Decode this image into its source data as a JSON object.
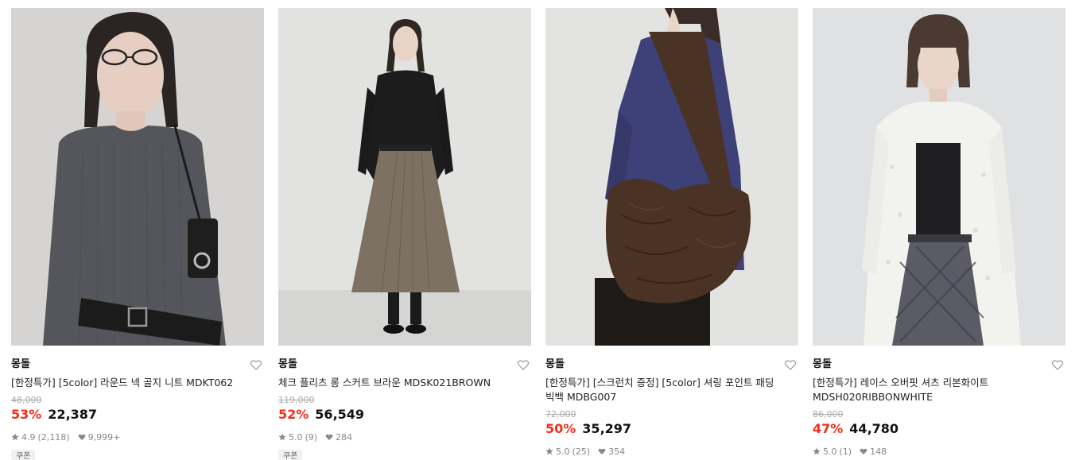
{
  "products": [
    {
      "brand": "몽돌",
      "name": "[한정특가] [5color] 라운드 넥 골지 니트 MDKT062",
      "original_price": "48,000",
      "discount": "53%",
      "price": "22,387",
      "rating": "4.9",
      "reviews": "(2,118)",
      "likes": "9,999+",
      "tag": "쿠폰",
      "image": "model-ribbed-knit-gray",
      "colors": {
        "bg": "#d9d8d6",
        "main": "#55565b",
        "accent": "#1e1e1e",
        "skin": "#e6cfc2",
        "hair": "#2a2522"
      }
    },
    {
      "brand": "몽돌",
      "name": "체크 플리츠 롱 스커트 브라운 MDSK021BROWN",
      "original_price": "119,000",
      "discount": "52%",
      "price": "56,549",
      "rating": "5.0",
      "reviews": "(9)",
      "likes": "284",
      "tag": "쿠폰",
      "image": "model-pleated-skirt-brown",
      "colors": {
        "bg": "#e2e2e0",
        "main": "#7d7262",
        "accent": "#1c1c1c",
        "skin": "#e8d3c6",
        "hair": "#2e2824"
      }
    },
    {
      "brand": "몽돌",
      "name": "[한정특가] [스크런치 증정] [5color] 셔링 포인트 패딩 빅백 MDBG007",
      "original_price": "72,000",
      "discount": "50%",
      "price": "35,297",
      "rating": "5.0",
      "reviews": "(25)",
      "likes": "354",
      "tag": "",
      "image": "model-padded-big-bag",
      "colors": {
        "bg": "#e3e3e1",
        "main": "#3e4177",
        "accent": "#4a3224",
        "skin": "#e8d4c8",
        "hair": "#3a2c26"
      }
    },
    {
      "brand": "몽돌",
      "name": "[한정특가] 레이스 오버핏 셔츠 리본화이트 MDSH020RIBBONWHITE",
      "original_price": "86,000",
      "discount": "47%",
      "price": "44,780",
      "rating": "5.0",
      "reviews": "(1)",
      "likes": "148",
      "tag": "",
      "image": "model-lace-shirt-white",
      "colors": {
        "bg": "#dfe1e2",
        "main": "#f2f2ef",
        "accent": "#2c2c30",
        "skin": "#ead5c9",
        "hair": "#4a3a32"
      }
    }
  ]
}
